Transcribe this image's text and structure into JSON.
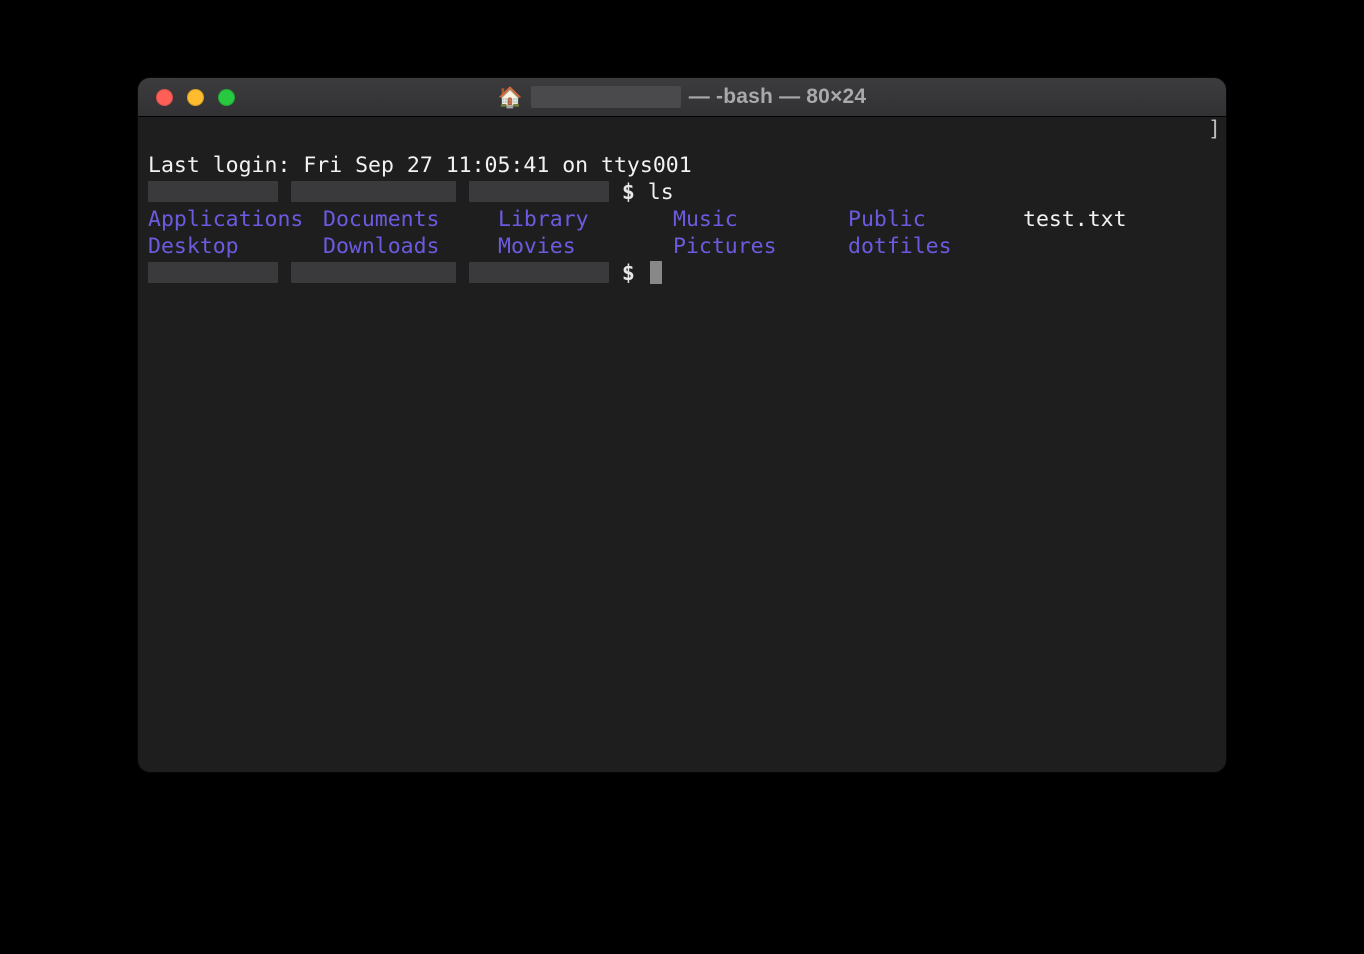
{
  "titlebar": {
    "title_suffix": " — -bash — 80×24"
  },
  "terminal": {
    "last_login_line": "Last login: Fri Sep 27 11:05:41 on ttys001",
    "prompt_symbol": "$",
    "command": "ls",
    "scroll_mark": "]",
    "ls_row1": {
      "c1": "Applications",
      "c2": "Documents",
      "c3": "Library",
      "c4": "Music",
      "c5": "Public",
      "c6": "test.txt"
    },
    "ls_row2": {
      "c1": "Desktop",
      "c2": "Downloads",
      "c3": "Movies",
      "c4": "Pictures",
      "c5": "dotfiles",
      "c6": ""
    }
  }
}
